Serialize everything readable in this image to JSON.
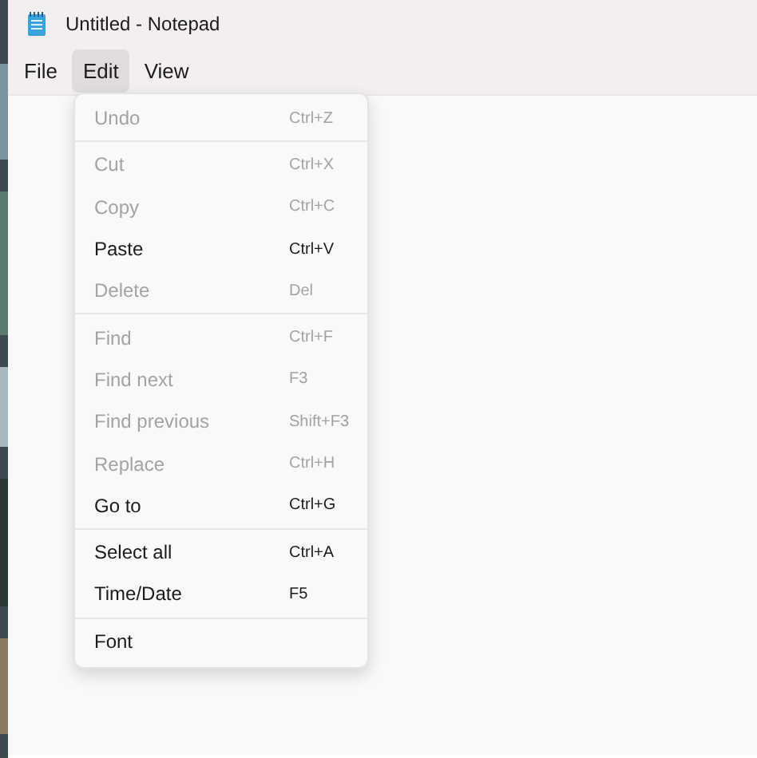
{
  "window": {
    "title": "Untitled - Notepad"
  },
  "menu_bar": [
    {
      "label": "File",
      "selected": false
    },
    {
      "label": "Edit",
      "selected": true
    },
    {
      "label": "View",
      "selected": false
    }
  ],
  "edit_menu": {
    "groups": [
      [
        {
          "label": "Undo",
          "shortcut": "Ctrl+Z",
          "disabled": true
        }
      ],
      [
        {
          "label": "Cut",
          "shortcut": "Ctrl+X",
          "disabled": true
        },
        {
          "label": "Copy",
          "shortcut": "Ctrl+C",
          "disabled": true
        },
        {
          "label": "Paste",
          "shortcut": "Ctrl+V",
          "disabled": false
        },
        {
          "label": "Delete",
          "shortcut": "Del",
          "disabled": true
        }
      ],
      [
        {
          "label": "Find",
          "shortcut": "Ctrl+F",
          "disabled": true
        },
        {
          "label": "Find next",
          "shortcut": "F3",
          "disabled": true
        },
        {
          "label": "Find previous",
          "shortcut": "Shift+F3",
          "disabled": true
        },
        {
          "label": "Replace",
          "shortcut": "Ctrl+H",
          "disabled": true
        },
        {
          "label": "Go to",
          "shortcut": "Ctrl+G",
          "disabled": false
        }
      ],
      [
        {
          "label": "Select all",
          "shortcut": "Ctrl+A",
          "disabled": false
        },
        {
          "label": "Time/Date",
          "shortcut": "F5",
          "disabled": false
        }
      ],
      [
        {
          "label": "Font",
          "disabled": false
        }
      ]
    ]
  }
}
